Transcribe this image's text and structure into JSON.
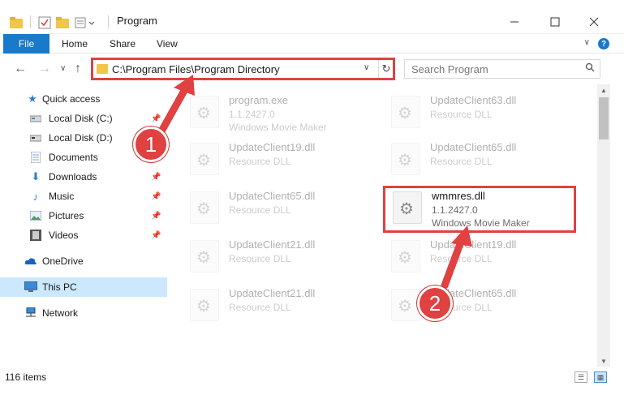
{
  "window": {
    "title": "Program",
    "minimize_icon": "minimize-icon",
    "maximize_icon": "maximize-icon",
    "close_icon": "close-icon"
  },
  "ribbon": {
    "tabs": [
      "File",
      "Home",
      "Share",
      "View"
    ],
    "help": "?"
  },
  "address": {
    "path": "C:\\Program Files\\Program Directory",
    "search_placeholder": "Search Program"
  },
  "sidebar": {
    "items": [
      {
        "label": "Quick access",
        "icon": "star-icon",
        "pinned": false
      },
      {
        "label": "Local Disk (C:)",
        "icon": "drive-icon",
        "pinned": true
      },
      {
        "label": "Local Disk (D:)",
        "icon": "drive-icon",
        "pinned": true
      },
      {
        "label": "Documents",
        "icon": "documents-icon",
        "pinned": true
      },
      {
        "label": "Downloads",
        "icon": "download-icon",
        "pinned": true
      },
      {
        "label": "Music",
        "icon": "music-icon",
        "pinned": true
      },
      {
        "label": "Pictures",
        "icon": "pictures-icon",
        "pinned": true
      },
      {
        "label": "Videos",
        "icon": "videos-icon",
        "pinned": true
      },
      {
        "label": "OneDrive",
        "icon": "cloud-icon",
        "pinned": false
      },
      {
        "label": "This PC",
        "icon": "computer-icon",
        "pinned": false,
        "selected": true
      },
      {
        "label": "Network",
        "icon": "network-icon",
        "pinned": false
      }
    ]
  },
  "files": [
    {
      "name": "program.exe",
      "meta1": "1.1.2427.0",
      "meta2": "Windows Movie Maker",
      "faded": true
    },
    {
      "name": "UpdateClient63.dll",
      "meta1": "Resource DLL",
      "meta2": "",
      "faded": true
    },
    {
      "name": "UpdateClient19.dll",
      "meta1": "Resource DLL",
      "meta2": "",
      "faded": true
    },
    {
      "name": "UpdateClient65.dll",
      "meta1": "Resource DLL",
      "meta2": "",
      "faded": true
    },
    {
      "name": "UpdateClient65.dll",
      "meta1": "Resource DLL",
      "meta2": "",
      "faded": true
    },
    {
      "name": "wmmres.dll",
      "meta1": "1.1.2427.0",
      "meta2": "Windows Movie Maker",
      "faded": false,
      "highlighted": true
    },
    {
      "name": "UpdateClient21.dll",
      "meta1": "Resource DLL",
      "meta2": "",
      "faded": true
    },
    {
      "name": "UpdateClient19.dll",
      "meta1": "Resource DLL",
      "meta2": "",
      "faded": true
    },
    {
      "name": "UpdateClient21.dll",
      "meta1": "Resource DLL",
      "meta2": "",
      "faded": true
    },
    {
      "name": "UpdateClient65.dll",
      "meta1": "Resource DLL",
      "meta2": "",
      "faded": true
    }
  ],
  "status": {
    "item_count": "116 items"
  },
  "annotations": {
    "step1": "1",
    "step2": "2",
    "color": "#e04141"
  }
}
